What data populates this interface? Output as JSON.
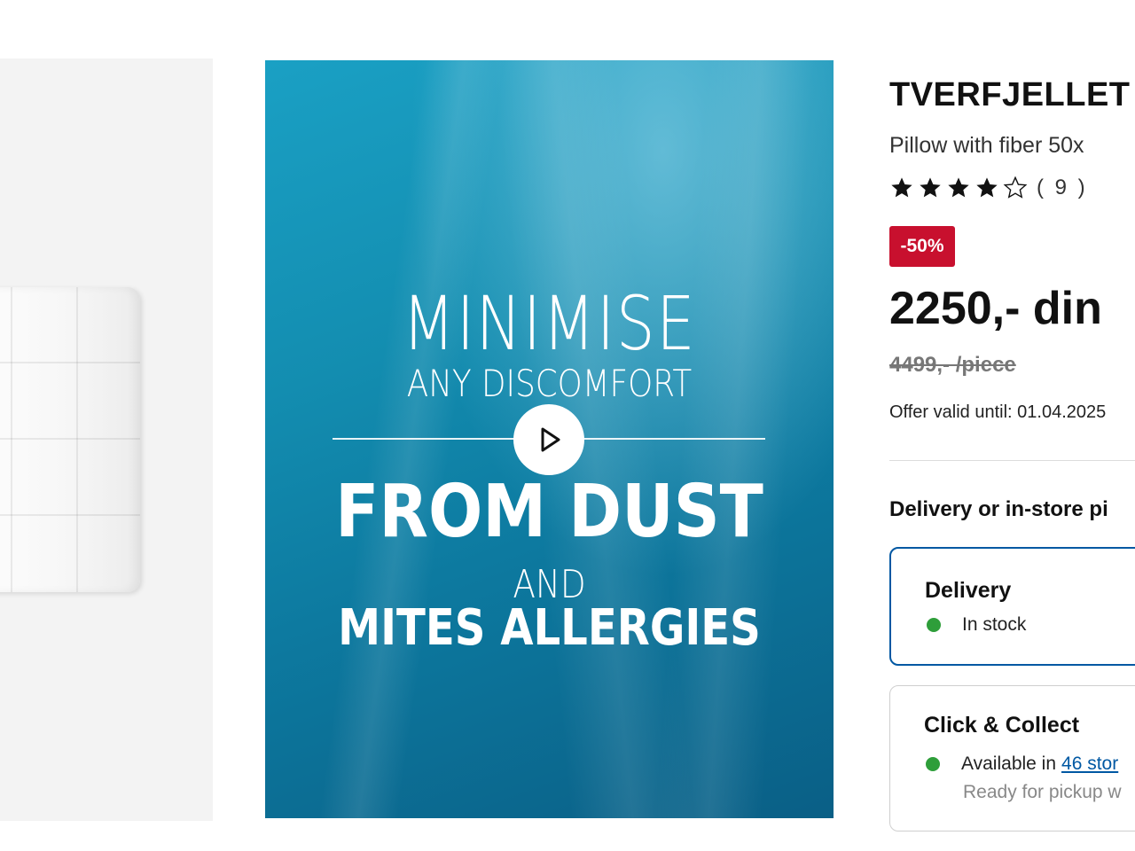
{
  "product": {
    "name": "TVERFJELLET",
    "description": "Pillow with fiber 50x",
    "rating": {
      "stars": 4,
      "max_stars": 5,
      "review_count_label": "( 9 )"
    },
    "discount_badge": "-50%",
    "price": "2250,- din",
    "old_price": "4499,- /piece",
    "offer_valid": "Offer valid until: 01.04.2025"
  },
  "video": {
    "line1": "MINIMISE",
    "line2": "ANY DISCOMFORT",
    "line3": "FROM DUST",
    "line4": "AND",
    "line5": "MITES ALLERGIES"
  },
  "fulfilment": {
    "heading": "Delivery or in-store pi",
    "delivery": {
      "title": "Delivery",
      "status": "In stock"
    },
    "click_collect": {
      "title": "Click & Collect",
      "status_prefix": "Available in",
      "stores_link": "46 stor",
      "note": "Ready for pickup w"
    }
  },
  "colors": {
    "accent_blue": "#0058a3",
    "discount_red": "#c8102e",
    "stock_green": "#2e9e3a"
  },
  "icons": {
    "play": "play-icon",
    "star_filled": "star-filled-icon",
    "star_empty": "star-empty-icon",
    "status_dot": "status-dot-icon"
  }
}
